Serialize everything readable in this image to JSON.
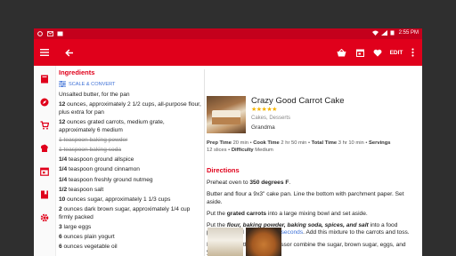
{
  "status_bar": {
    "time": "2:55 PM",
    "battery": "4"
  },
  "toolbar": {
    "edit_label": "EDIT"
  },
  "ingredients": {
    "heading": "Ingredients",
    "scale_label": "SCALE & CONVERT",
    "items": [
      {
        "bold": "",
        "text": "Unsalted butter, for the pan",
        "struck": false
      },
      {
        "bold": "12",
        "text": " ounces, approximately 2 1/2 cups, all-purpose flour, plus extra for pan",
        "struck": false
      },
      {
        "bold": "12",
        "text": " ounces grated carrots, medium grate, approximately 6 medium",
        "struck": false
      },
      {
        "bold": "",
        "text": "1 teaspoon baking powder",
        "struck": true
      },
      {
        "bold": "",
        "text": "1 teaspoon baking soda",
        "struck": true
      },
      {
        "bold": "1/4",
        "text": " teaspoon ground allspice",
        "struck": false
      },
      {
        "bold": "1/4",
        "text": " teaspoon ground cinnamon",
        "struck": false
      },
      {
        "bold": "1/4",
        "text": " teaspoon freshly ground nutmeg",
        "struck": false
      },
      {
        "bold": "1/2",
        "text": " teaspoon salt",
        "struck": false
      },
      {
        "bold": "10",
        "text": " ounces sugar, approximately 1 1/3 cups",
        "struck": false
      },
      {
        "bold": "2",
        "text": " ounces dark brown sugar, approximately 1/4 cup firmly packed",
        "struck": false
      },
      {
        "bold": "3",
        "text": " large eggs",
        "struck": false
      },
      {
        "bold": "6",
        "text": " ounces plain yogurt",
        "struck": false
      },
      {
        "bold": "6",
        "text": " ounces vegetable oil",
        "struck": false
      }
    ]
  },
  "recipe": {
    "title": "Crazy Good Carrot Cake",
    "stars": "★★★★★",
    "category": "Cakes, Desserts",
    "source": "Grandma",
    "prep_label": "Prep Time",
    "prep_value": "20 min",
    "cook_label": "Cook Time",
    "cook_value": "2 hr 50 min",
    "total_label": "Total Time",
    "total_value": "3 hr 10 min",
    "servings_label": "Servings",
    "servings_value": "12 slices",
    "difficulty_label": "Difficulty",
    "difficulty_value": "Medium"
  },
  "directions": {
    "heading": "Directions",
    "p1_pre": "Preheat oven to ",
    "p1_bold": "350 degrees F",
    "p1_post": ".",
    "p2": "Butter and flour a 9x3\" cake pan. Line the bottom with parchment paper. Set aside.",
    "p3_pre": "Put the ",
    "p3_bold": "grated carrots",
    "p3_post": " into a large mixing bowl and set aside.",
    "p4_pre": "Put the ",
    "p4_bold": "flour, baking powder, baking soda, spices, and salt",
    "p4_mid": " into a food processor and process for ",
    "p4_link": "5 seconds",
    "p4_post": ". Add this mixture to the carrots and toss.",
    "p5": "In the bowl of the food processor combine the sugar, brown sugar, eggs, and yogurt."
  },
  "colors": {
    "accent": "#e0001b",
    "link": "#3b6fd6",
    "star": "#f4b400"
  }
}
